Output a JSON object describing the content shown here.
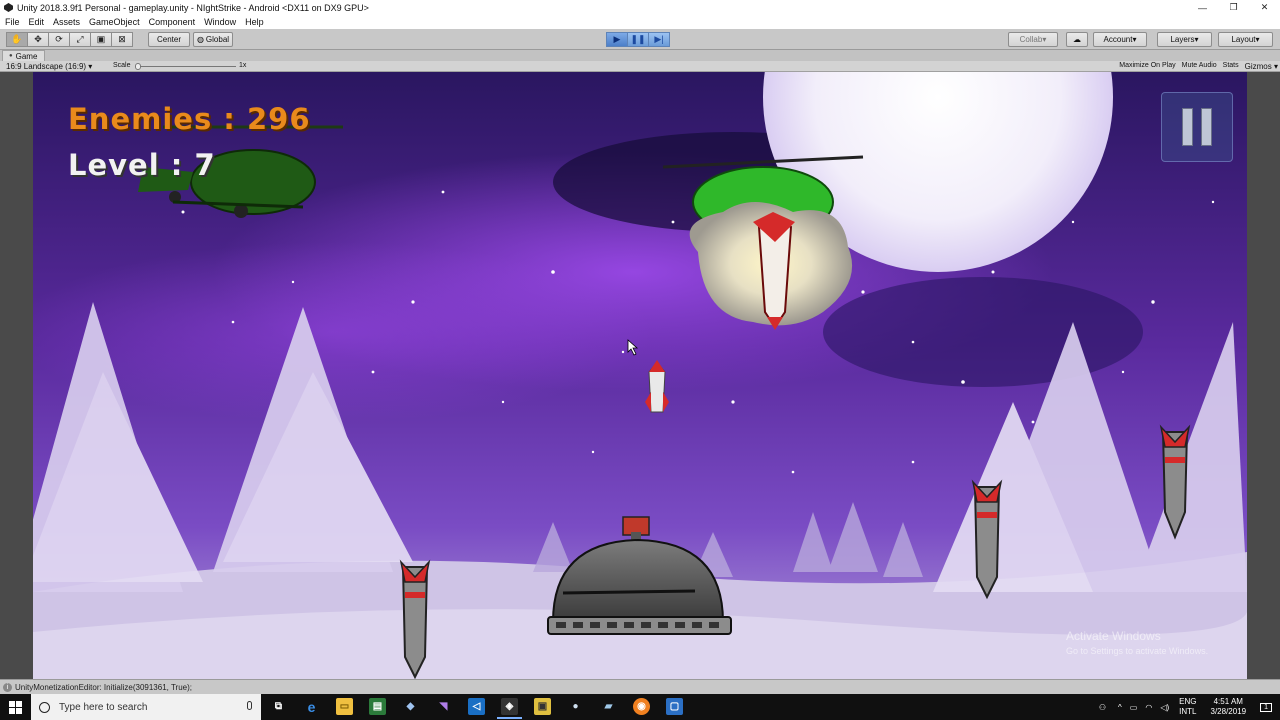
{
  "window": {
    "title": "Unity 2018.3.9f1 Personal - gameplay.unity - NIghtStrike - Android <DX11 on DX9 GPU>",
    "controls": {
      "minimize": "—",
      "restore": "❐",
      "close": "✕"
    }
  },
  "menu": [
    "File",
    "Edit",
    "Assets",
    "GameObject",
    "Component",
    "Window",
    "Help"
  ],
  "toolbar": {
    "pivot_label": "Center",
    "space_label": "Global",
    "collab_label": "Collab",
    "account_label": "Account",
    "layers_label": "Layers",
    "layout_label": "Layout"
  },
  "game_tab": {
    "label": "Game",
    "aspect": "16:9 Landscape (16:9)",
    "scale_label": "Scale",
    "scale_value": "1x",
    "options": [
      "Maximize On Play",
      "Mute Audio",
      "Stats",
      "Gizmos"
    ]
  },
  "hud": {
    "enemies_label": "Enemies : 296",
    "level_label": "Level : 7"
  },
  "watermark": {
    "line1": "Activate Windows",
    "line2": "Go to Settings to activate Windows."
  },
  "status": "UnityMonetizationEditor: Initialize(3091361, True);",
  "taskbar": {
    "search_placeholder": "Type here to search",
    "lang_top": "ENG",
    "lang_bottom": "INTL",
    "time": "4:51 AM",
    "date": "3/28/2019",
    "notification_count": "1"
  },
  "colors": {
    "sky_top": "#2a1660",
    "sky_mid": "#5a2a9e",
    "aurora": "#8a3cd6",
    "snow": "#e4dcf2",
    "helicopter_green": "#2fb82a",
    "enemies_text": "#e98a1c",
    "play_button_blue": "#6b9bd8"
  }
}
